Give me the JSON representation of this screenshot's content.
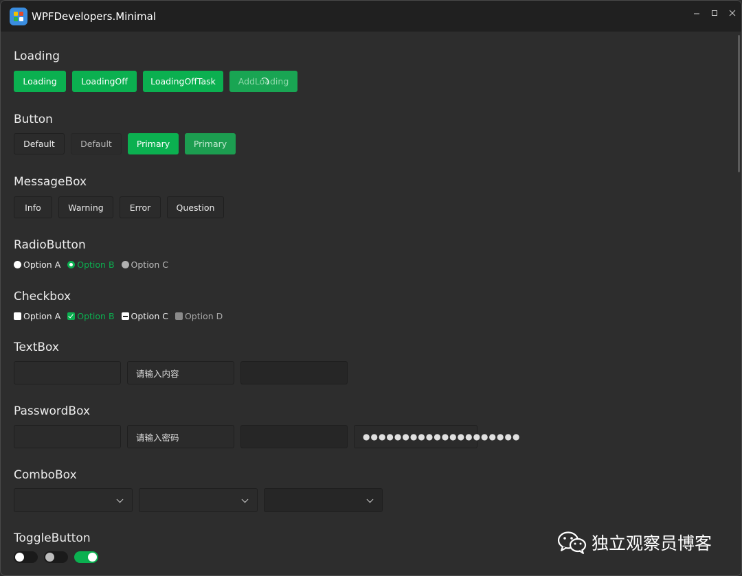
{
  "window": {
    "title": "WPFDevelopers.Minimal",
    "controls": [
      "minimize-icon",
      "maximize-icon",
      "close-icon"
    ],
    "accent": "#0bb050"
  },
  "loading": {
    "title": "Loading",
    "buttons": [
      "Loading",
      "LoadingOff",
      "LoadingOffTask",
      "AddLoading"
    ]
  },
  "button": {
    "title": "Button",
    "buttons": [
      "Default",
      "Default",
      "Primary",
      "Primary"
    ]
  },
  "messagebox": {
    "title": "MessageBox",
    "buttons": [
      "Info",
      "Warning",
      "Error",
      "Question"
    ]
  },
  "radio": {
    "title": "RadioButton",
    "options": [
      "Option A",
      "Option B",
      "Option C"
    ]
  },
  "checkbox": {
    "title": "Checkbox",
    "options": [
      "Option A",
      "Option B",
      "Option C",
      "Option D"
    ]
  },
  "textbox": {
    "title": "TextBox",
    "values": [
      "",
      "请输入内容",
      ""
    ]
  },
  "passwordbox": {
    "title": "PasswordBox",
    "values": [
      "",
      "请输入密码",
      "",
      "●●●●●●●●●●●●●●●●●●●●"
    ]
  },
  "combobox": {
    "title": "ComboBox"
  },
  "togglebutton": {
    "title": "ToggleButton"
  },
  "watermark": {
    "text": "独立观察员博客"
  }
}
